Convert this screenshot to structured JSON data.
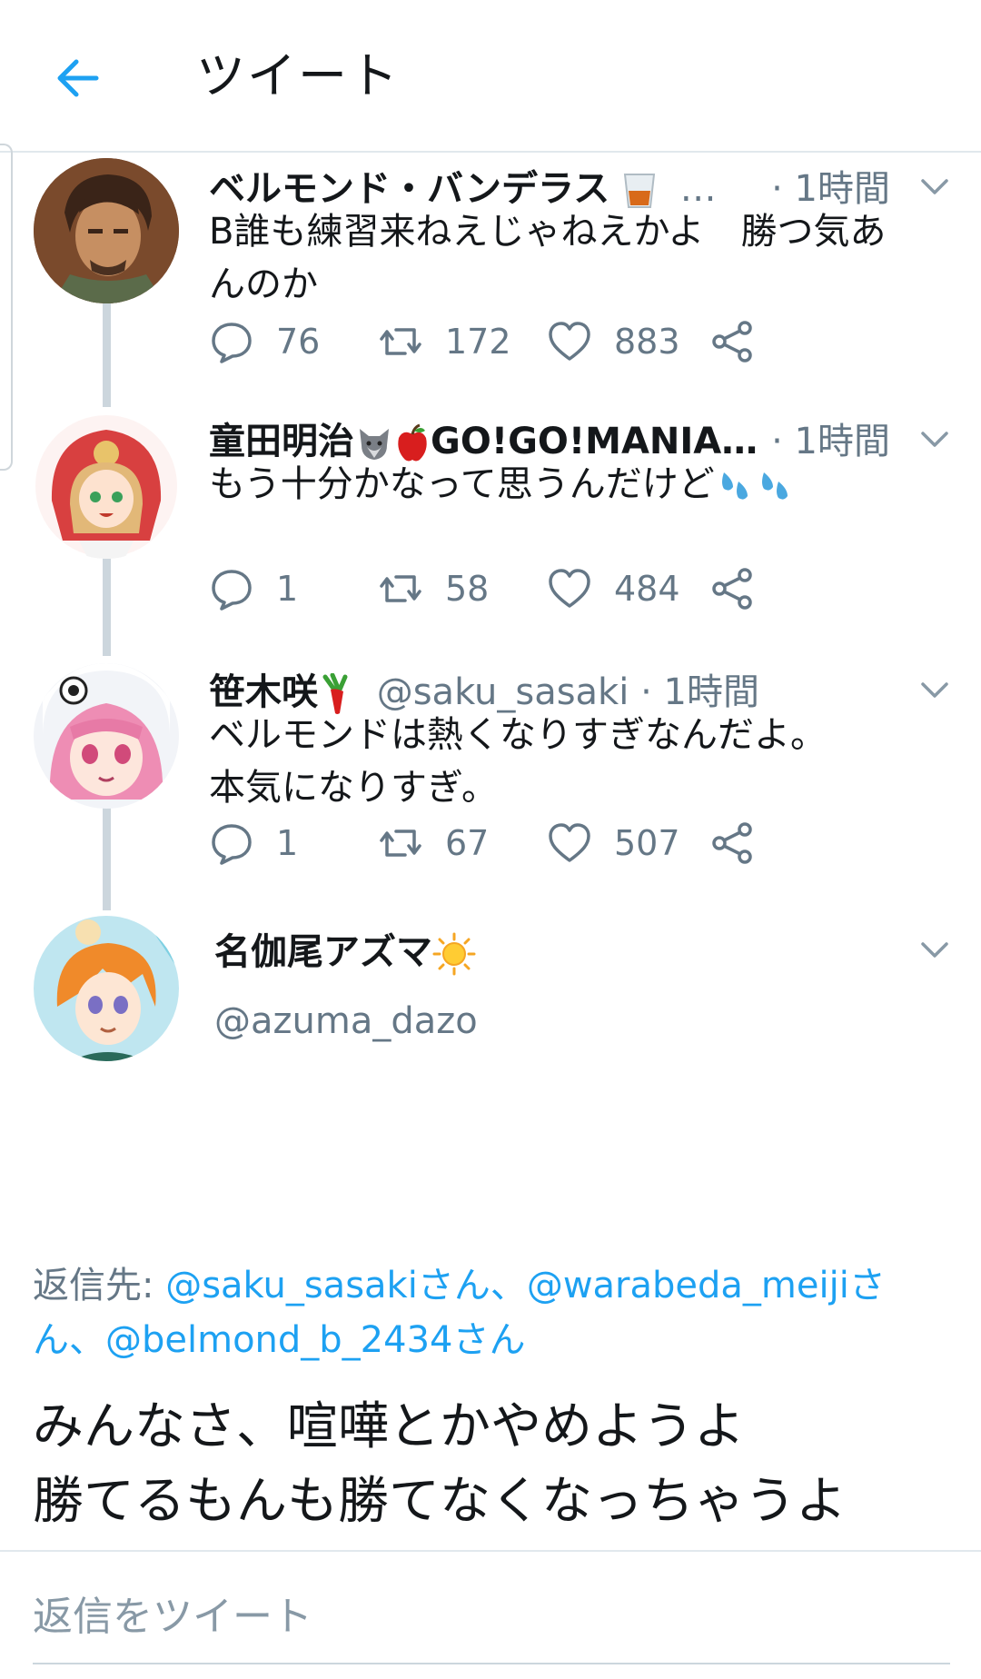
{
  "header": {
    "title": "ツイート",
    "back_icon": "arrow-left-icon",
    "accent": "#1da1f2"
  },
  "tweets": [
    {
      "name": "ベルモンド・バンデラス",
      "name_emoji": "glass-icon",
      "ellipsis": "…",
      "handle": "",
      "time": "· 1時間",
      "text_lines": [
        "B誰も練習来ねえじゃねえかよ　勝つ気あ",
        "んのか"
      ],
      "replies": "76",
      "retweets": "172",
      "likes": "883"
    },
    {
      "name": "童田明治",
      "name_suffix": "GO!GO!MANIA…",
      "name_emoji": [
        "wolf-icon",
        "apple-icon"
      ],
      "time": "· 1時間",
      "text": "もう十分かなって思うんだけど",
      "text_emoji": "sweat-drops-icon",
      "replies": "1",
      "retweets": "58",
      "likes": "484"
    },
    {
      "name": "笹木咲",
      "name_emoji": "radish-icon",
      "handle": "@saku_sasaki",
      "time": "· 1時間",
      "text_lines": [
        "ベルモンドは熱くなりすぎなんだよ。",
        "本気になりすぎ。"
      ],
      "replies": "1",
      "retweets": "67",
      "likes": "507"
    }
  ],
  "main_tweet": {
    "name": "名伽尾アズマ",
    "name_emoji": "sun-icon",
    "handle": "@azuma_dazo",
    "reply_prefix": "返信先: ",
    "mention1": "@saku_sasakiさん、",
    "mention2": "@warabeda_meijiさ",
    "mention2b": "ん、",
    "mention3": "@belmond_b_2434さん",
    "text_lines": [
      "みんなさ、喧嘩とかやめようよ",
      "勝てるもんも勝てなくなっちゃうよ"
    ]
  },
  "reply_box": {
    "placeholder": "返信をツイート"
  },
  "colors": {
    "text": "#14171a",
    "secondary": "#657786",
    "link": "#1da1f2",
    "thread": "#ccd6dd"
  }
}
